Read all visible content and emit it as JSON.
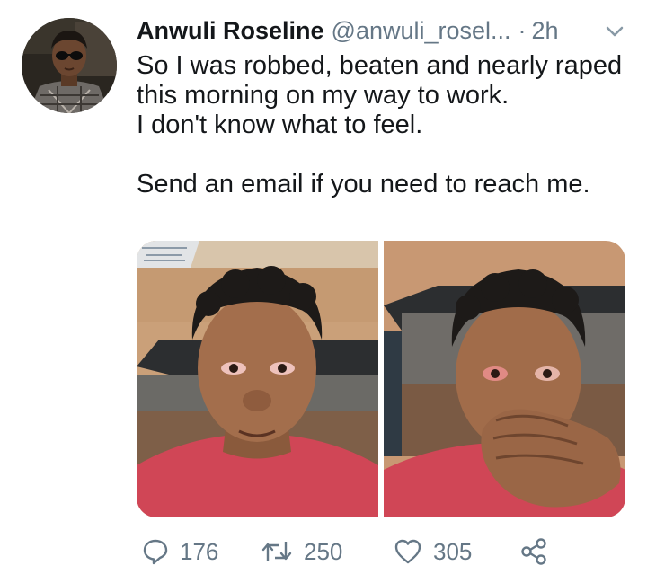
{
  "tweet": {
    "author": {
      "name": "Anwuli Roseline",
      "handle": "@anwuli_rosel...",
      "separator": "·",
      "time": "2h"
    },
    "text": {
      "line1": "So I was robbed, beaten and nearly raped",
      "line2": "this morning on my way to work.",
      "line3": "I don't know what to feel.",
      "line4": "Send an email if you need to reach me."
    },
    "media": {
      "count": 2,
      "photos": [
        "selfie-photo-1",
        "selfie-photo-2"
      ]
    },
    "actions": {
      "replies": "176",
      "retweets": "250",
      "likes": "305"
    },
    "icons": {
      "reply": "comment-bubble-icon",
      "retweet": "retweet-arrows-icon",
      "like": "heart-icon",
      "share": "share-nodes-icon",
      "menu": "chevron-down-icon"
    },
    "colors": {
      "text_primary": "#14171a",
      "text_secondary": "#657786",
      "background": "#ffffff"
    }
  }
}
